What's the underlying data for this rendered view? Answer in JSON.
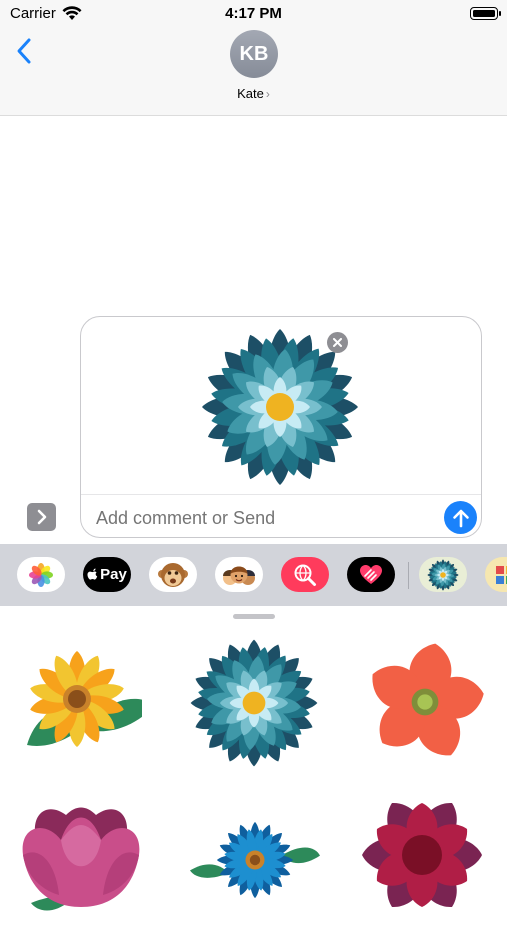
{
  "status_bar": {
    "carrier": "Carrier",
    "time": "4:17 PM"
  },
  "header": {
    "back_icon": "chevron-left-icon",
    "avatar_initials": "KB",
    "contact_name": "Kate",
    "contact_chevron": "›"
  },
  "compose": {
    "placeholder": "Add comment or Send",
    "value": "",
    "attached_sticker": "teal-dahlia-flower",
    "colors": {
      "send": "#1a82fb"
    }
  },
  "app_strip": {
    "apps": [
      {
        "name": "Photos",
        "icon": "photos-icon"
      },
      {
        "name": "Apple Pay",
        "label": "Pay",
        "icon": "apple-pay-icon"
      },
      {
        "name": "Animoji",
        "icon": "monkey-icon"
      },
      {
        "name": "Memoji",
        "icon": "memoji-icon"
      },
      {
        "name": "Images",
        "icon": "globe-search-icon"
      },
      {
        "name": "Digital Touch",
        "icon": "heart-touch-icon"
      },
      {
        "name": "Flower Stickers",
        "icon": "flower-app-icon"
      },
      {
        "name": "More",
        "icon": "blocks-icon"
      }
    ]
  },
  "stickers": [
    {
      "name": "orange-daisy",
      "colors": [
        "#f7a21b",
        "#f2c530",
        "#2d8a5a"
      ]
    },
    {
      "name": "teal-dahlia",
      "colors": [
        "#1d5f7a",
        "#3f98a8",
        "#9fd6e4",
        "#efb321"
      ]
    },
    {
      "name": "red-poppy",
      "colors": [
        "#f26045",
        "#8bb54a"
      ]
    },
    {
      "name": "pink-tulip",
      "colors": [
        "#c94e8a",
        "#a63a6e"
      ]
    },
    {
      "name": "blue-daisy",
      "colors": [
        "#1d8fd0",
        "#0f5f9e",
        "#2d8a5a"
      ]
    },
    {
      "name": "crimson-flower",
      "colors": [
        "#b01e46",
        "#7a0f26",
        "#5c1a3a"
      ]
    }
  ]
}
